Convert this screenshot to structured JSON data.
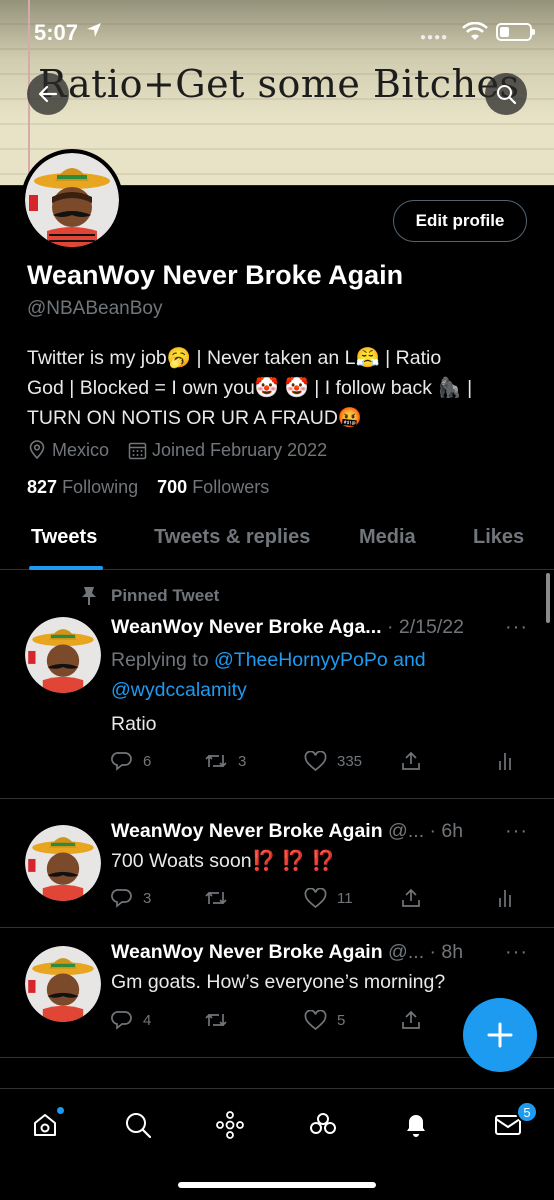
{
  "status_bar": {
    "time": "5:07"
  },
  "banner": {
    "text": "Ratio+Get some Bitches"
  },
  "profile": {
    "edit_label": "Edit profile",
    "display_name": "WeanWoy Never Broke Again",
    "handle": "@NBABeanBoy",
    "bio_line1": "Twitter is my job🥱 | Never taken an L😤 | Ratio",
    "bio_line2": "God | Blocked = I own you🤡 🤡 | I follow back 🦍 |",
    "bio_line3": "TURN ON NOTIS OR UR A FRAUD🤬",
    "location": "Mexico",
    "joined": "Joined February 2022",
    "following_count": "827",
    "following_label": "Following",
    "followers_count": "700",
    "followers_label": "Followers"
  },
  "tabs": [
    "Tweets",
    "Tweets & replies",
    "Media",
    "Likes"
  ],
  "tweets": [
    {
      "pinned_label": "Pinned Tweet",
      "name": "WeanWoy Never Broke Aga...",
      "meta": " · 2/15/22",
      "replying_prefix": "Replying to ",
      "replying_user1": "@TheeHornyyPoPo",
      "replying_and": " and",
      "replying_user2": "@wydccalamity",
      "text": "Ratio",
      "replies": "6",
      "retweets": "3",
      "likes": "335"
    },
    {
      "name": "WeanWoy Never Broke Again",
      "meta": " @... · 6h",
      "text": "700 Woats soon⁉️ ⁉️ ⁉️",
      "replies": "3",
      "retweets": "",
      "likes": "11"
    },
    {
      "name": "WeanWoy Never Broke Again",
      "meta": " @... · 8h",
      "text": "Gm goats. How’s everyone’s morning?",
      "replies": "4",
      "retweets": "",
      "likes": "5"
    }
  ],
  "messages_badge": "5",
  "colors": {
    "accent": "#1d9bf0",
    "background": "#000000",
    "secondary_text": "#71767b"
  }
}
